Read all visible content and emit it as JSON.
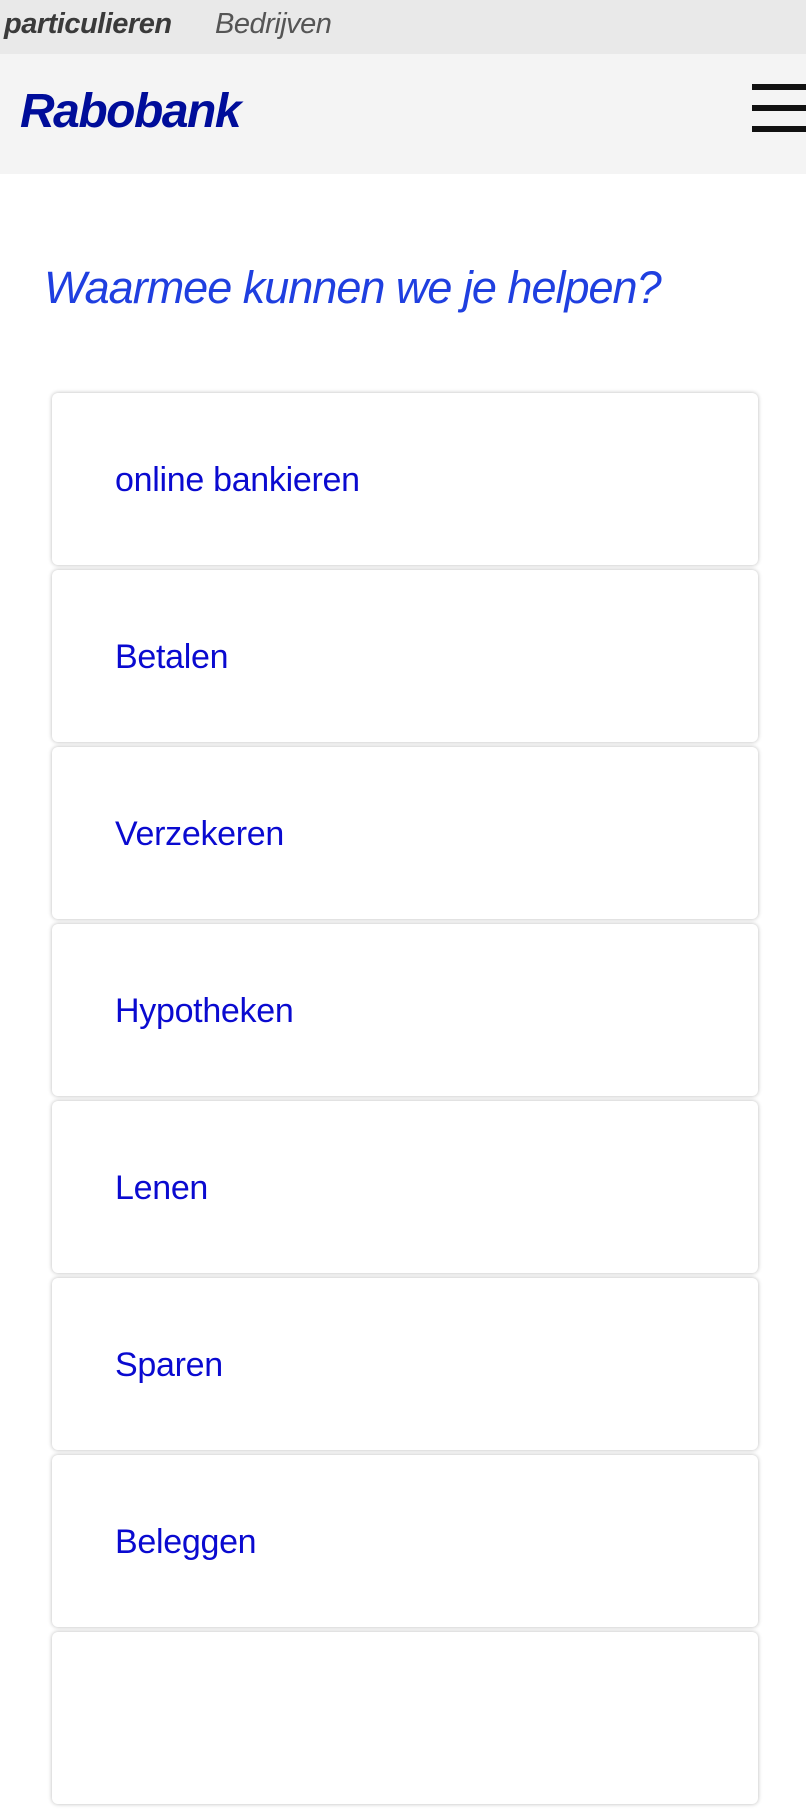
{
  "segments": {
    "particulieren": "particulieren",
    "bedrijven": "Bedrijven"
  },
  "header": {
    "logo": "Rabobank",
    "menu_icon": "hamburger-menu-icon"
  },
  "main": {
    "question": "Waarmee kunnen we je helpen?",
    "items": [
      {
        "label": "online bankieren"
      },
      {
        "label": "Betalen"
      },
      {
        "label": "Verzekeren"
      },
      {
        "label": "Hypotheken"
      },
      {
        "label": "Lenen"
      },
      {
        "label": "Sparen"
      },
      {
        "label": "Beleggen"
      },
      {
        "label": ""
      }
    ]
  },
  "colors": {
    "brand": "#000d9a",
    "question": "#1f3fe0",
    "link": "#0a0ad0",
    "topbar": "#e9e9e9",
    "header": "#f4f4f4"
  }
}
